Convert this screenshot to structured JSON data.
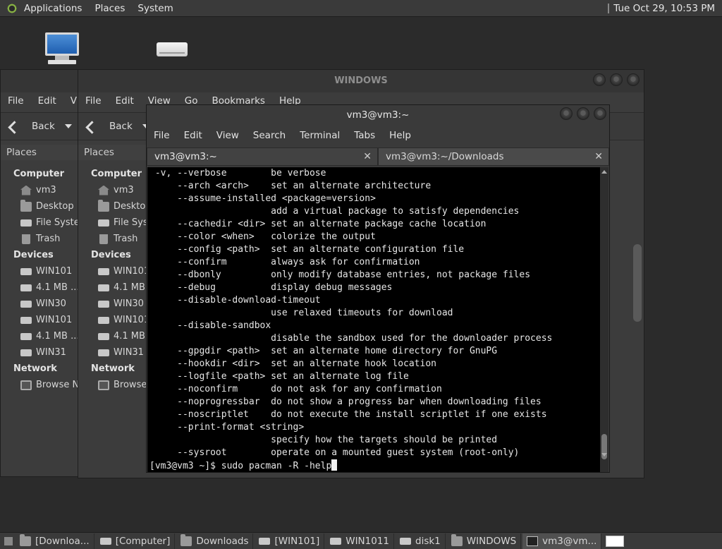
{
  "top_panel": {
    "menus": [
      "Applications",
      "Places",
      "System"
    ],
    "clock": "Tue Oct 29, 10:53 PM"
  },
  "desktop_icons": [
    "computer-icon",
    "drive-icon"
  ],
  "file_manager_back": {
    "menus": [
      "File",
      "Edit",
      "Vi"
    ],
    "back_label": "Back",
    "places_label": "Places",
    "sidebar": {
      "computer_header": "Computer",
      "computer_items": [
        "vm3",
        "Desktop",
        "File Syster",
        "Trash"
      ],
      "devices_header": "Devices",
      "device_items": [
        "WIN101",
        "4.1 MB ...",
        "WIN30",
        "WIN101",
        "4.1 MB ...",
        "WIN31"
      ],
      "network_header": "Network",
      "network_items": [
        "Browse N"
      ]
    }
  },
  "file_manager_front": {
    "title": "WINDOWS",
    "menus": [
      "File",
      "Edit",
      "View",
      "Go",
      "Bookmarks",
      "Help"
    ],
    "back_label": "Back",
    "places_label": "Places",
    "sidebar": {
      "computer_header": "Computer",
      "computer_items": [
        "vm3",
        "Deskto",
        "File Sys",
        "Trash"
      ],
      "devices_header": "Devices",
      "device_items": [
        "WIN101",
        "4.1 MB",
        "WIN30",
        "WIN101",
        "4.1 MB",
        "WIN31"
      ],
      "network_header": "Network",
      "network_items": [
        "Browse"
      ]
    }
  },
  "terminal": {
    "title": "vm3@vm3:~",
    "menus": [
      "File",
      "Edit",
      "View",
      "Search",
      "Terminal",
      "Tabs",
      "Help"
    ],
    "tabs": [
      {
        "label": "vm3@vm3:~",
        "active": true
      },
      {
        "label": "vm3@vm3:~/Downloads",
        "active": false
      }
    ],
    "output": " -v, --verbose        be verbose\n     --arch <arch>    set an alternate architecture\n     --assume-installed <package=version>\n                      add a virtual package to satisfy dependencies\n     --cachedir <dir> set an alternate package cache location\n     --color <when>   colorize the output\n     --config <path>  set an alternate configuration file\n     --confirm        always ask for confirmation\n     --dbonly         only modify database entries, not package files\n     --debug          display debug messages\n     --disable-download-timeout\n                      use relaxed timeouts for download\n     --disable-sandbox\n                      disable the sandbox used for the downloader process\n     --gpgdir <path>  set an alternate home directory for GnuPG\n     --hookdir <dir>  set an alternate hook location\n     --logfile <path> set an alternate log file\n     --noconfirm      do not ask for any confirmation\n     --noprogressbar  do not show a progress bar when downloading files\n     --noscriptlet    do not execute the install scriptlet if one exists\n     --print-format <string>\n                      specify how the targets should be printed\n     --sysroot        operate on a mounted guest system (root-only)",
    "prompt": "[vm3@vm3 ~]$ ",
    "command": "sudo pacman -R -help"
  },
  "taskbar": {
    "tasks": [
      {
        "label": "[Downloa...",
        "icon": "folder-icon"
      },
      {
        "label": "[Computer]",
        "icon": "computer-icon"
      },
      {
        "label": "Downloads",
        "icon": "folder-icon"
      },
      {
        "label": "[WIN101]",
        "icon": "drive-icon"
      },
      {
        "label": "WIN1011",
        "icon": "drive-icon"
      },
      {
        "label": "disk1",
        "icon": "drive-icon"
      },
      {
        "label": "WINDOWS",
        "icon": "folder-icon"
      },
      {
        "label": "vm3@vm...",
        "icon": "terminal-icon"
      }
    ]
  }
}
